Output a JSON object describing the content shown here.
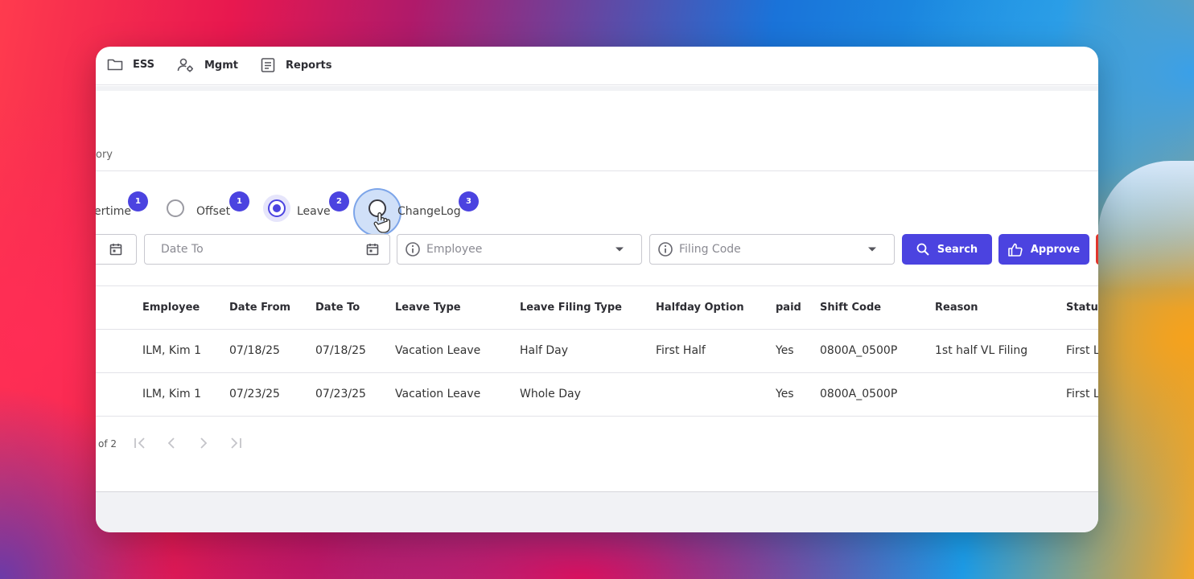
{
  "nav": {
    "ess_label": "ESS",
    "mgmt_label": "Mgmt",
    "reports_label": "Reports"
  },
  "breadcrumb": "ory",
  "filing_types": [
    {
      "label": "ertime",
      "badge": "1",
      "checked": false
    },
    {
      "label": "Offset",
      "badge": "1",
      "checked": false
    },
    {
      "label": "Leave",
      "badge": "2",
      "checked": true
    },
    {
      "label": "ChangeLog",
      "badge": "3",
      "checked": false
    }
  ],
  "filters": {
    "date_to_placeholder": "Date To",
    "employee_placeholder": "Employee",
    "filing_code_placeholder": "Filing Code",
    "search_label": "Search",
    "approve_label": "Approve"
  },
  "table": {
    "columns": [
      "Employee",
      "Date From",
      "Date To",
      "Leave Type",
      "Leave Filing Type",
      "Halfday Option",
      "paid",
      "Shift Code",
      "Reason",
      "Status"
    ],
    "rows": [
      [
        "ILM, Kim 1",
        "07/18/25",
        "07/18/25",
        "Vacation Leave",
        "Half Day",
        "First Half",
        "Yes",
        "0800A_0500P",
        "1st half VL Filing",
        "First L"
      ],
      [
        "ILM, Kim 1",
        "07/23/25",
        "07/23/25",
        "Vacation Leave",
        "Whole Day",
        "",
        "Yes",
        "0800A_0500P",
        "",
        "First L"
      ]
    ]
  },
  "pagination": {
    "text": "of 2"
  },
  "colors": {
    "accent": "#4b43e0",
    "danger": "#e0362c"
  }
}
